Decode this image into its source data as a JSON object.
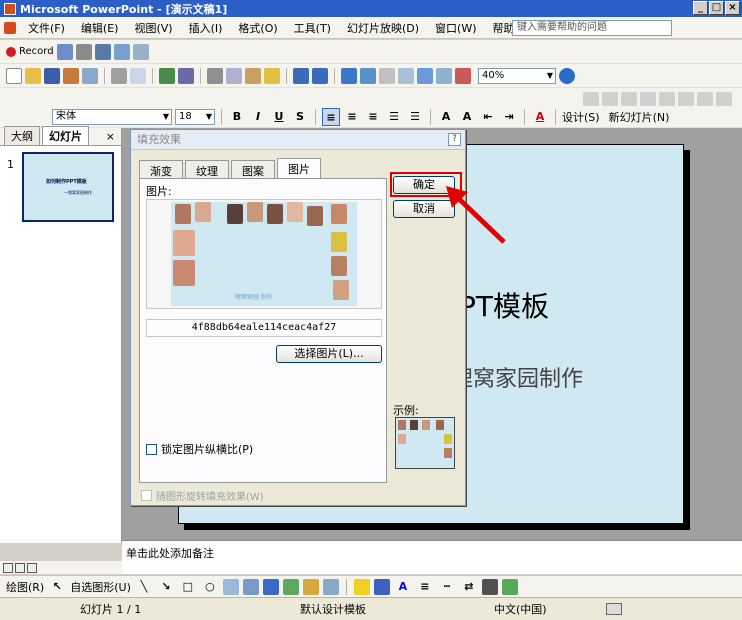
{
  "window": {
    "title": "Microsoft PowerPoint - [演示文稿1]"
  },
  "menu": {
    "items": [
      "文件(F)",
      "编辑(E)",
      "视图(V)",
      "插入(I)",
      "格式(O)",
      "工具(T)",
      "幻灯片放映(D)",
      "窗口(W)",
      "帮助(H)"
    ],
    "help_placeholder": "键入需要帮助的问题"
  },
  "toolbar1": {
    "record_label": "Record"
  },
  "toolbar_std": {
    "zoom": "40%"
  },
  "format_bar": {
    "font": "宋体",
    "size": "18",
    "design_label": "设计(S)",
    "new_slide_label": "新幻灯片(N)"
  },
  "left_pane": {
    "tabs": [
      "大纲",
      "幻灯片"
    ],
    "slide_number": "1",
    "thumb_title": "如何制作PPT模板",
    "thumb_sub": "—哩窝家园制作"
  },
  "slide": {
    "title": "PT模板",
    "subtitle": "哩窝家园制作"
  },
  "dialog": {
    "title": "填充效果",
    "tabs": [
      "渐变",
      "纹理",
      "图案",
      "图片"
    ],
    "picture_label": "图片:",
    "image_caption": "哩窝家园 制作",
    "hash": "4f88db64eale114ceac4af27",
    "select_picture": "选择图片(L)...",
    "lock_aspect": "锁定图片纵横比(P)",
    "rotate_with_shape": "随图形旋转填充效果(W)",
    "ok": "确定",
    "cancel": "取消",
    "sample_label": "示例:"
  },
  "notes": {
    "placeholder": "单击此处添加备注"
  },
  "drawbar": {
    "draw_label": "绘图(R)",
    "autoshapes_label": "自选图形(U)"
  },
  "status": {
    "slide_info": "幻灯片 1 / 1",
    "template": "默认设计模板",
    "language": "中文(中国)"
  },
  "colors": {
    "title_bar": "#2b5fc7",
    "slide_bg": "#cfe8f1",
    "highlight": "#e00000"
  }
}
